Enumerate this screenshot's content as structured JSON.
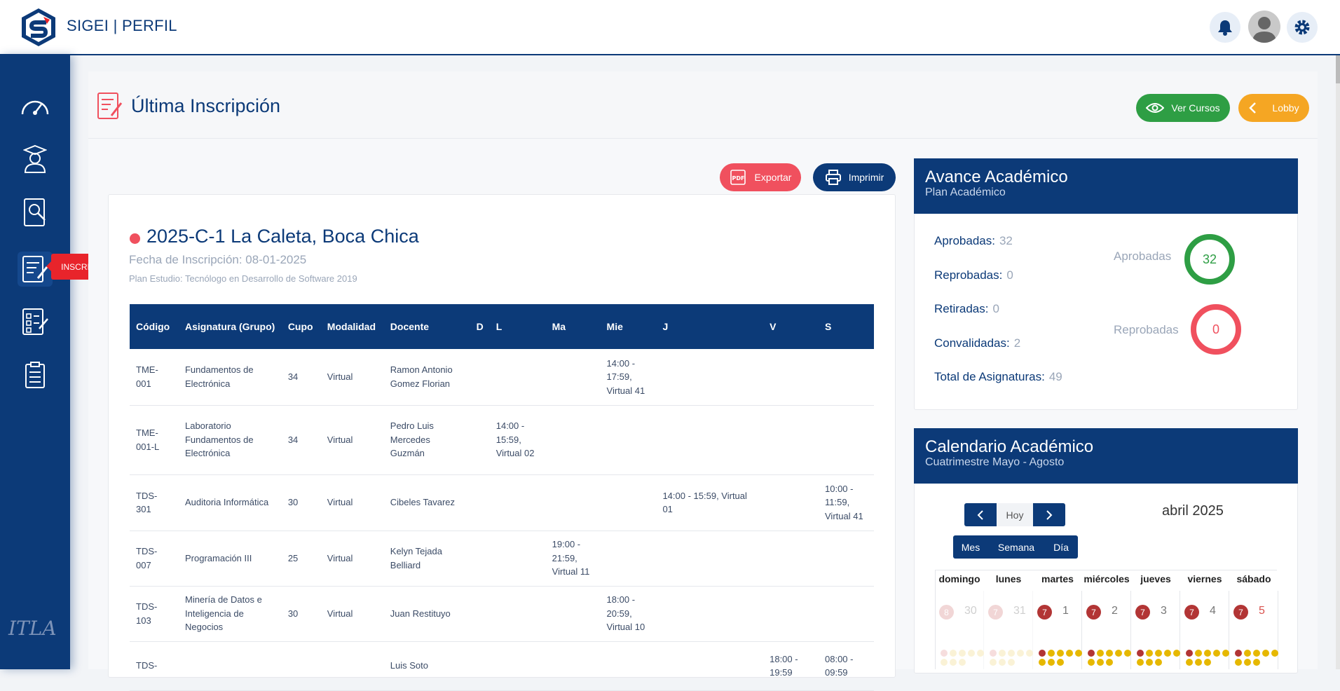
{
  "app": {
    "title": "SIGEI | PERFIL"
  },
  "sidebar": {
    "items": [
      {
        "icon": "dashboard-icon"
      },
      {
        "icon": "student-icon"
      },
      {
        "icon": "id-card-search-icon"
      },
      {
        "icon": "enrollment-form-icon"
      },
      {
        "icon": "checklist-icon"
      },
      {
        "icon": "clipboard-list-icon"
      }
    ],
    "active_tooltip": "INSCRIPCIÓN",
    "footer_logo": "ITLA"
  },
  "page": {
    "title": "Última Inscripción",
    "ver_cursos": "Ver Cursos",
    "lobby": "Lobby",
    "exportar": "Exportar",
    "imprimir": "Imprimir"
  },
  "inscripcion": {
    "title": "2025-C-1 La Caleta, Boca Chica",
    "fecha": "Fecha de Inscripción: 08-01-2025",
    "plan": "Plan Estudio: Tecnólogo en Desarrollo de Software 2019",
    "headers": [
      "Código",
      "Asignatura (Grupo)",
      "Cupo",
      "Modalidad",
      "Docente",
      "D",
      "L",
      "Ma",
      "Mie",
      "J",
      "V",
      "S"
    ],
    "rows": [
      {
        "codigo": "TME-001",
        "asignatura": "Fundamentos de Electrónica",
        "cupo": "34",
        "modalidad": "Virtual",
        "docente": "Ramon Antonio Gomez Florian",
        "d": "",
        "l": "",
        "ma": "",
        "mie": "14:00 - 17:59, Virtual 41",
        "j": "",
        "v": "",
        "s": ""
      },
      {
        "codigo": "TME-001-L",
        "asignatura": "Laboratorio Fundamentos de Electrónica",
        "cupo": "34",
        "modalidad": "Virtual",
        "docente": "Pedro Luis Mercedes Guzmán",
        "d": "",
        "l": "14:00 - 15:59, Virtual 02",
        "ma": "",
        "mie": "",
        "j": "",
        "v": "",
        "s": ""
      },
      {
        "codigo": "TDS-301",
        "asignatura": "Auditoria Informática",
        "cupo": "30",
        "modalidad": "Virtual",
        "docente": "Cibeles Tavarez",
        "d": "",
        "l": "",
        "ma": "",
        "mie": "",
        "j": "14:00 - 15:59, Virtual 01",
        "v": "",
        "s": "10:00 - 11:59, Virtual 41"
      },
      {
        "codigo": "TDS-007",
        "asignatura": "Programación III",
        "cupo": "25",
        "modalidad": "Virtual",
        "docente": "Kelyn Tejada Belliard",
        "d": "",
        "l": "",
        "ma": "19:00 - 21:59, Virtual 11",
        "mie": "",
        "j": "",
        "v": "",
        "s": ""
      },
      {
        "codigo": "TDS-103",
        "asignatura": "Minería de Datos e Inteligencia de Negocios",
        "cupo": "30",
        "modalidad": "Virtual",
        "docente": "Juan Restituyo",
        "d": "",
        "l": "",
        "ma": "",
        "mie": "18:00 - 20:59, Virtual 10",
        "j": "",
        "v": "",
        "s": ""
      },
      {
        "codigo": "TDS-",
        "asignatura": "",
        "cupo": "",
        "modalidad": "",
        "docente": "Luis Soto",
        "d": "",
        "l": "",
        "ma": "",
        "mie": "",
        "j": "",
        "v": "18:00 - 19:59",
        "s": "08:00 - 09:59"
      }
    ]
  },
  "avance": {
    "title": "Avance Académico",
    "subtitle": "Plan Académico",
    "stats": [
      {
        "label": "Aprobadas:",
        "value": "32"
      },
      {
        "label": "Reprobadas:",
        "value": "0"
      },
      {
        "label": "Retiradas:",
        "value": "0"
      },
      {
        "label": "Convalidadas:",
        "value": "2"
      },
      {
        "label": "Total de Asignaturas:",
        "value": "49"
      }
    ],
    "ring_aprobadas": {
      "label": "Aprobadas",
      "value": "32",
      "color": "#2e9e44"
    },
    "ring_reprobadas": {
      "label": "Reprobadas",
      "value": "0",
      "color": "#f0505e"
    }
  },
  "calendario": {
    "title": "Calendario Académico",
    "subtitle": "Cuatrimestre Mayo - Agosto",
    "hoy": "Hoy",
    "views": [
      "Mes",
      "Semana",
      "Día"
    ],
    "month": "abril 2025",
    "weekdays": [
      "domingo",
      "lunes",
      "martes",
      "miércoles",
      "jueves",
      "viernes",
      "sábado"
    ],
    "first_week": [
      {
        "badge": "8",
        "num": "30",
        "faded": true
      },
      {
        "badge": "7",
        "num": "31",
        "faded": true
      },
      {
        "badge": "7",
        "num": "1",
        "faded": false
      },
      {
        "badge": "7",
        "num": "2",
        "faded": false
      },
      {
        "badge": "7",
        "num": "3",
        "faded": false
      },
      {
        "badge": "7",
        "num": "4",
        "faded": false
      },
      {
        "badge": "7",
        "num": "5",
        "faded": false
      }
    ]
  }
}
